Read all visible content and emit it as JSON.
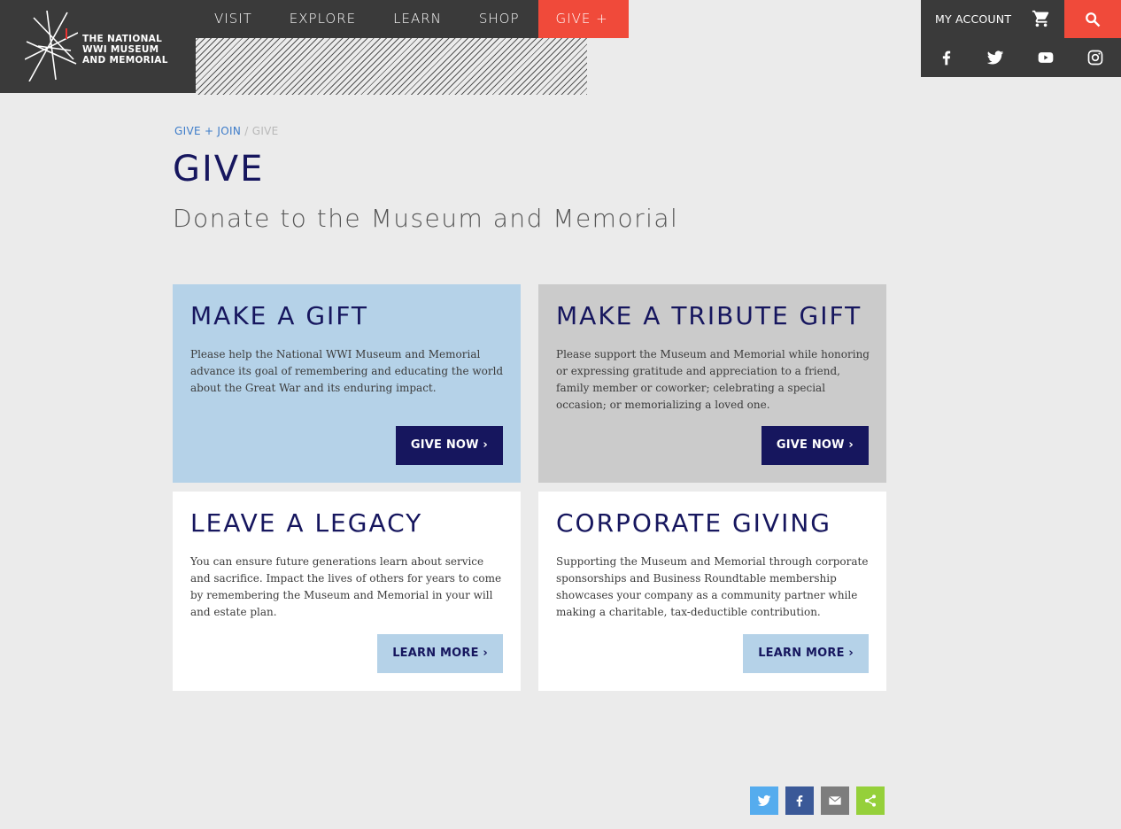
{
  "header": {
    "logo_lines": [
      "THE NATIONAL",
      "WWI MUSEUM",
      "AND MEMORIAL"
    ],
    "nav": [
      "VISIT",
      "EXPLORE",
      "LEARN",
      "SHOP",
      "GIVE + JOIN"
    ],
    "my_account": "MY ACCOUNT"
  },
  "breadcrumb": {
    "parent": "GIVE + JOIN",
    "separator": "/",
    "current": "GIVE"
  },
  "page": {
    "title": "GIVE",
    "subtitle": "Donate to the Museum and Memorial"
  },
  "cards": [
    {
      "title": "MAKE A GIFT",
      "text": "Please help the National WWI Museum and Memorial advance its goal of remembering and educating the world about the Great War and its enduring impact.",
      "button": "GIVE NOW ›"
    },
    {
      "title": "MAKE A TRIBUTE GIFT",
      "text": "Please support the Museum and Memorial while honoring or expressing gratitude and appreciation to a friend, family member or coworker; celebrating a special occasion; or memorializing a loved one.",
      "button": "GIVE NOW ›"
    },
    {
      "title": "LEAVE A LEGACY",
      "text": "You can ensure future generations learn about service and sacrifice. Impact the lives of others for years to come by remembering the Museum and Memorial in your will and estate plan.",
      "button": "LEARN MORE ›"
    },
    {
      "title": "CORPORATE GIVING",
      "text": "Supporting the Museum and Memorial through corporate sponsorships and Business Roundtable membership showcases your company as a community partner while making a charitable, tax-deductible contribution.",
      "button": "LEARN MORE ›"
    }
  ],
  "colors": {
    "accent_red": "#f04a3a",
    "navy": "#16165e",
    "light_blue": "#b5d2e8",
    "header_dark": "#3a3a3a",
    "twitter": "#55acee",
    "facebook": "#3b5998",
    "email": "#7d7d7d",
    "share": "#95d03a"
  },
  "icons": {
    "social": [
      "facebook-icon",
      "twitter-icon",
      "youtube-icon",
      "instagram-icon"
    ],
    "share": [
      "twitter-share-icon",
      "facebook-share-icon",
      "email-share-icon",
      "share-icon"
    ]
  }
}
